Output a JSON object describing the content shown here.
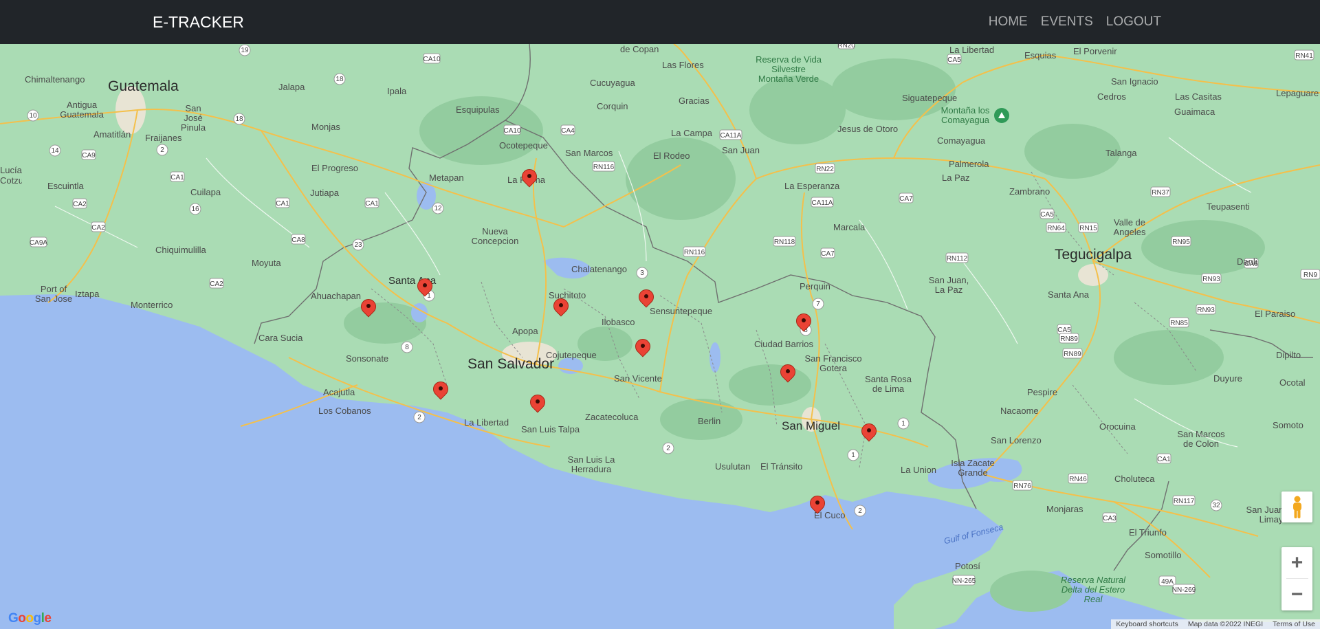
{
  "navbar": {
    "brand": "E-TRACKER",
    "links": [
      "HOME",
      "EVENTS",
      "LOGOUT"
    ]
  },
  "map": {
    "colors": {
      "land": "#aadcb4",
      "water": "#9cbcf0",
      "road": "#f4c04b",
      "marker": "#ea4335"
    },
    "country_labels": [
      "Guatemala",
      "San Salvador",
      "San Miguel",
      "Tegucigalpa"
    ],
    "place_labels": [
      "Chimaltenango",
      "Jalapa",
      "Ipala",
      "Esquipulas",
      "Cucuyagua",
      "Las Flores",
      "Gracias",
      "La Libertad",
      "Esquias",
      "El Porvenir",
      "San Ignacio",
      "Cedros",
      "Las Casitas",
      "Guaimaca",
      "Antigua Guatemala",
      "San José Pinula",
      "Amatitlán",
      "Fraijanes",
      "Monjas",
      "Corquin",
      "La Campa",
      "San Juan",
      "Jesus de Otoro",
      "Siguatepeque",
      "Comayagua",
      "Talanga",
      "Ocotepeque",
      "San Marcos",
      "El Rodeo",
      "Palmerola",
      "La Paz",
      "Zambrano",
      "Teupasenti",
      "El Progreso",
      "Metapan",
      "La Palma",
      "La Esperanza",
      "Marcala",
      "Escuintla",
      "Cuilapa",
      "Jutiapa",
      "Nueva Concepcion",
      "Valle de Angeles",
      "Chiquimulilla",
      "Moyuta",
      "Chalatenango",
      "Santa Ana",
      "Danli",
      "Port of San Jose",
      "Iztapa",
      "Monterrico",
      "Ahuachapan",
      "Suchitoto",
      "Sensuntepeque",
      "Perquin",
      "San Juan, La Paz",
      "Santa Ana",
      "El Paraiso",
      "Ilobasco",
      "Apopa",
      "Cara Sucia",
      "Ciudad Barrios",
      "Sonsonate",
      "Cojutepeque",
      "San Francisco Gotera",
      "San Vicente",
      "Santa Rosa de Lima",
      "Pespire",
      "Duyure",
      "Ocotal",
      "Acajutla",
      "Los Cobanos",
      "Nacaome",
      "Berlin",
      "La Libertad",
      "San Luis Talpa",
      "Zacatecoluca",
      "Orocuina",
      "Somoto",
      "San Lorenzo",
      "San Marcos de Colon",
      "San Luis La Herradura",
      "Usulutan",
      "El Tránsito",
      "La Union",
      "Isla Zacate Grande",
      "Choluteca",
      "Monjaras",
      "El Triunfo",
      "San Juan de Limay",
      "El Cuco",
      "Somotillo",
      "Potosí",
      "Dipilto",
      "Lepaguare",
      "Lucía",
      "Cotzumalguapa",
      "Montaña los Comayagua",
      "Reserva de Vida Silvestre Montaña Verde",
      "de Copan",
      "Reserva Natural Delta del Estero Real"
    ],
    "water_labels": [
      "Gulf of Fonseca"
    ],
    "markers": [
      {
        "name": "La Palma"
      },
      {
        "name": "Santa Ana"
      },
      {
        "name": "Ahuachapan"
      },
      {
        "name": "Suchitoto"
      },
      {
        "name": "Sensuntepeque"
      },
      {
        "name": "Perquin"
      },
      {
        "name": "Ilobasco"
      },
      {
        "name": "San Francisco Gotera"
      },
      {
        "name": "Sonsonate"
      },
      {
        "name": "San Luis Talpa"
      },
      {
        "name": "Santa Rosa de Lima"
      },
      {
        "name": "El Cuco"
      }
    ],
    "controls": {
      "zoom_in": "+",
      "zoom_out": "−",
      "pegman": "street-view-pegman-icon"
    },
    "attribution": {
      "logo": "Google",
      "items": [
        "Keyboard shortcuts",
        "Map data ©2022 INEGI",
        "Terms of Use"
      ]
    }
  }
}
